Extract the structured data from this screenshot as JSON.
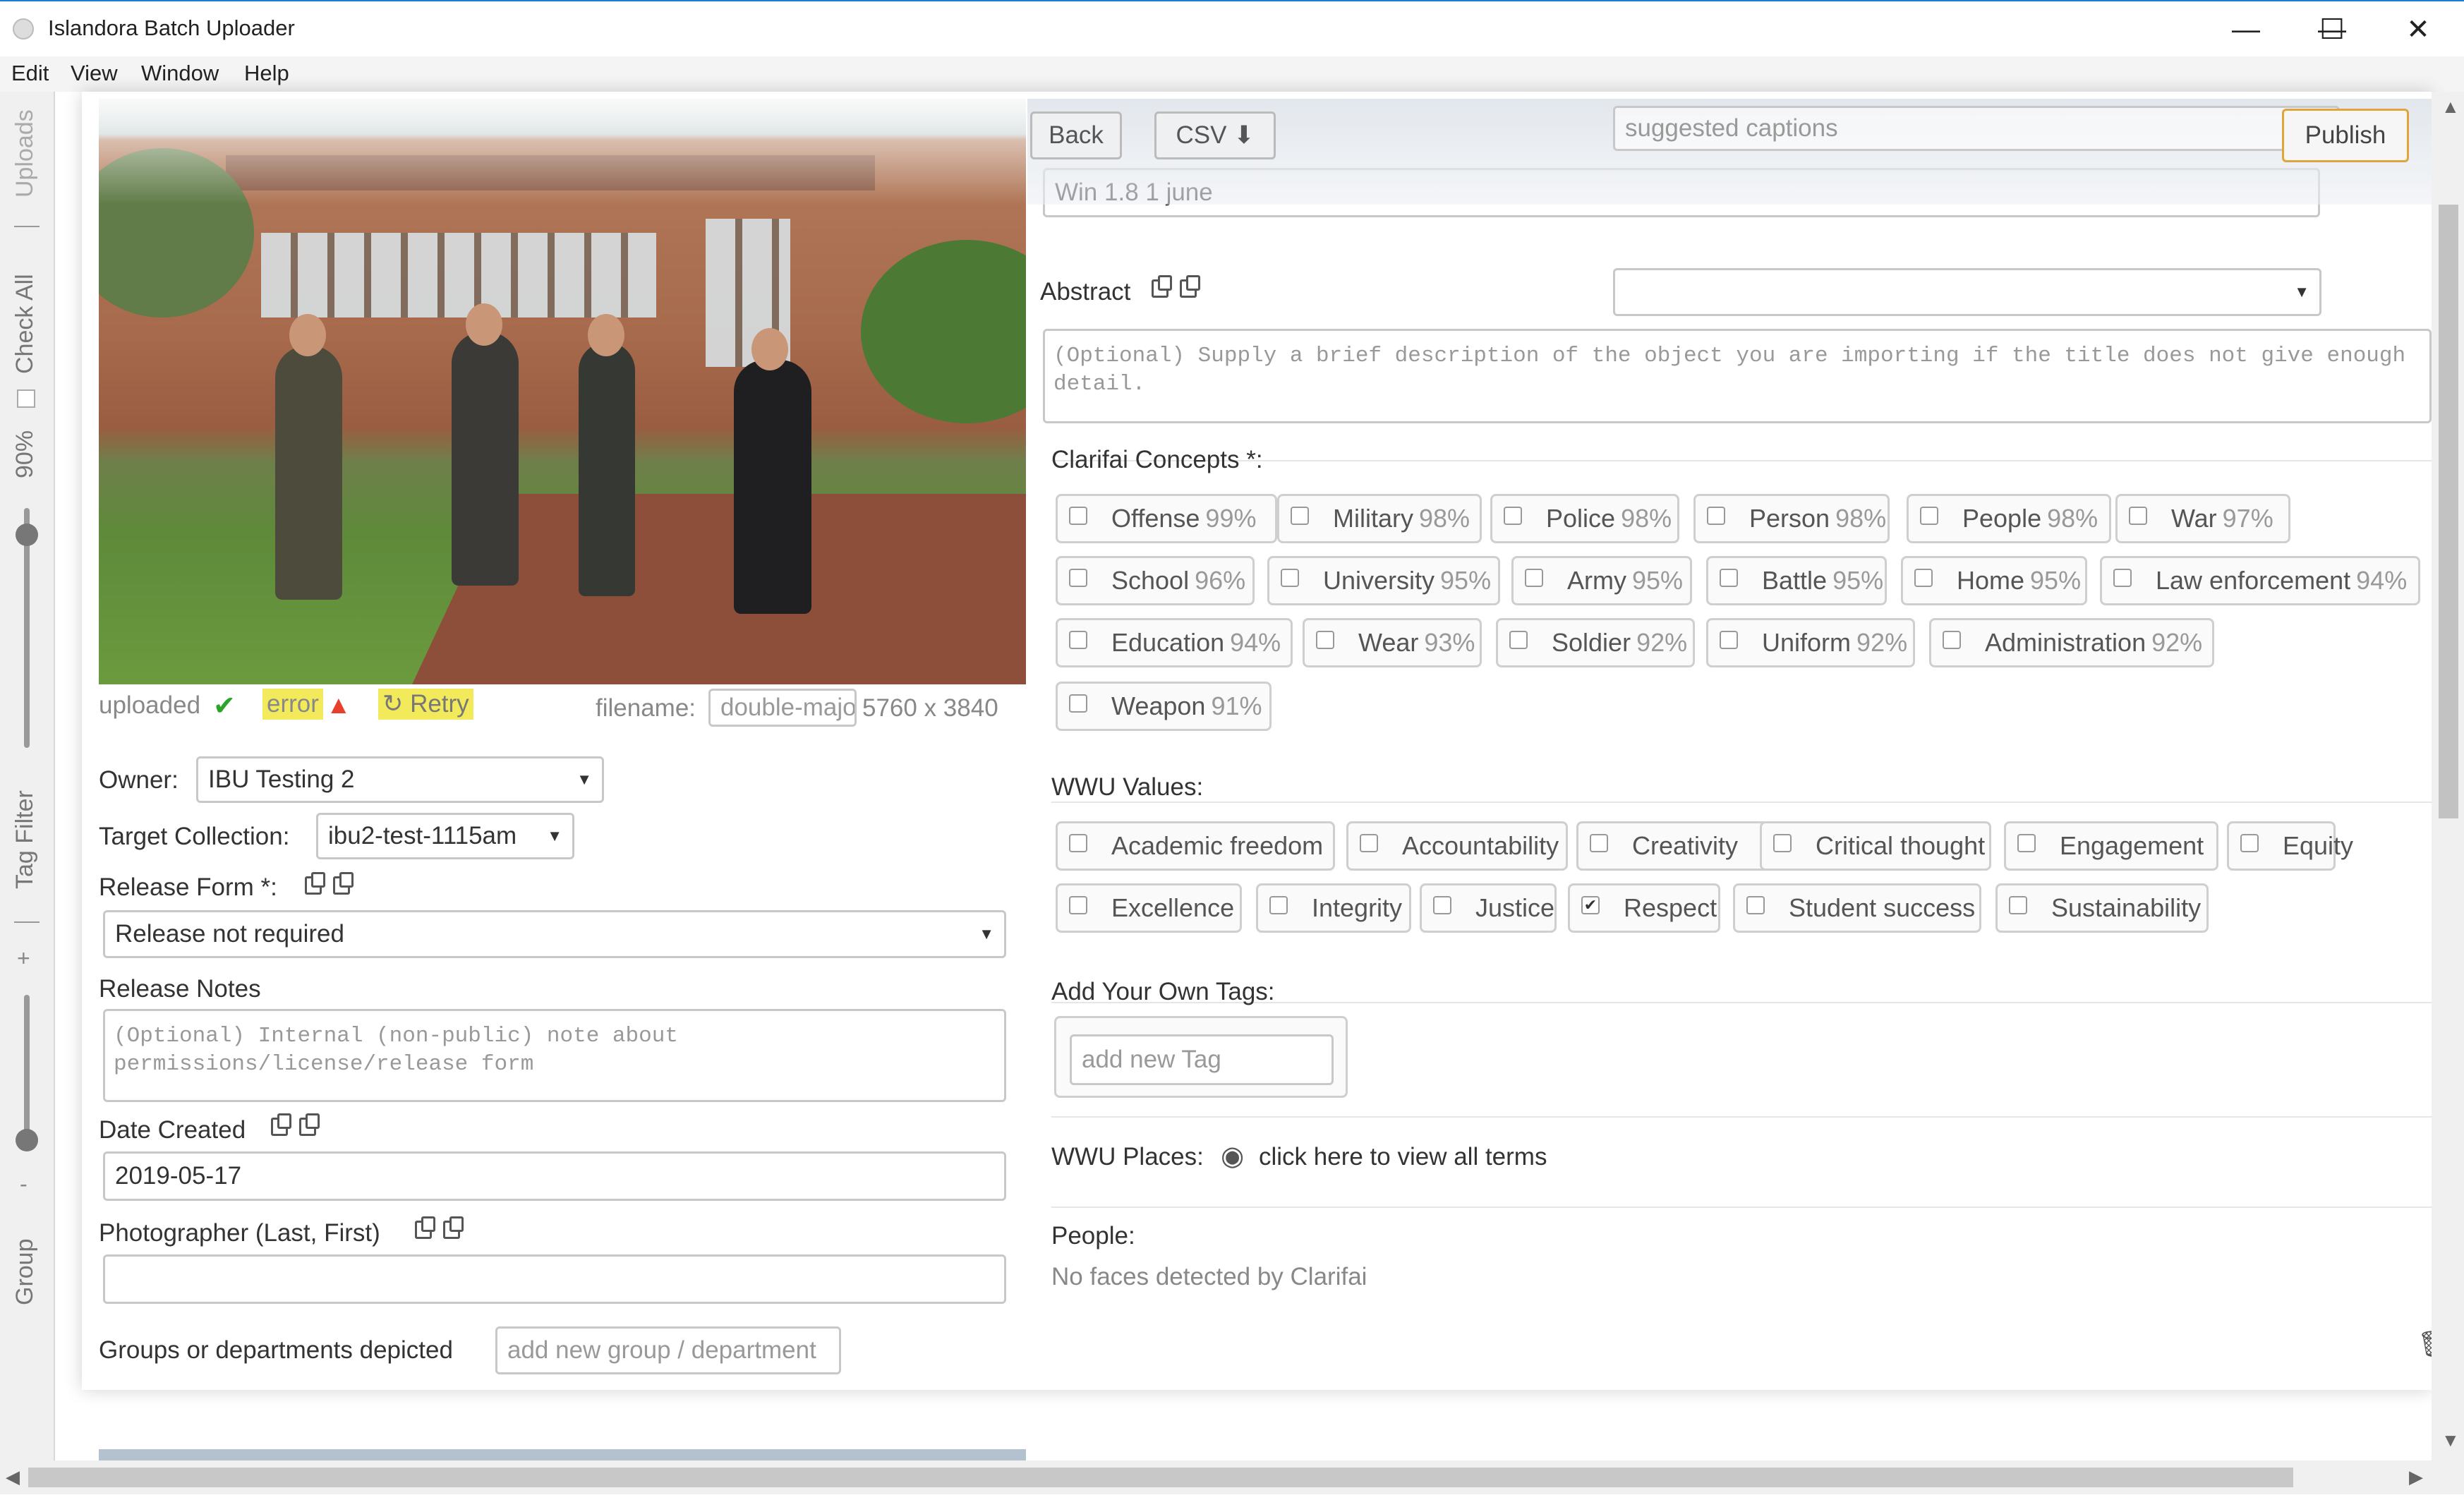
{
  "window": {
    "title": "Islandora Batch Uploader",
    "minimize": "—",
    "maximize": "☐",
    "close": "✕"
  },
  "menu": [
    "Edit",
    "View",
    "Window",
    "Help"
  ],
  "sidebar": {
    "uploads": "Uploads",
    "check_all": "Check All",
    "zoom": "90%",
    "tag_filter": "Tag Filter",
    "plus": "+",
    "minus": "-",
    "group": "Group"
  },
  "toolbar": {
    "back": "Back",
    "csv": "CSV",
    "captions_placeholder": "suggested captions",
    "publish": "Publish"
  },
  "status": {
    "uploaded": "uploaded",
    "error": "error",
    "retry": "Retry",
    "filename_label": "filename:",
    "filename_placeholder": "double-major",
    "dimensions": "5760 x 3840"
  },
  "form": {
    "owner_label": "Owner:",
    "owner_value": "IBU Testing 2",
    "collection_label": "Target Collection:",
    "collection_value": "ibu2-test-1115am",
    "release_form_label": "Release Form *:",
    "release_form_value": "Release not required",
    "release_notes_label": "Release Notes",
    "release_notes_placeholder": "(Optional) Internal (non-public) note about permissions/license/release form",
    "date_label": "Date Created",
    "date_value": "2019-05-17",
    "photographer_label": "Photographer (Last, First)",
    "photographer_value": "",
    "groups_label": "Groups or departments depicted",
    "groups_placeholder": "add new group / department"
  },
  "right": {
    "title_value": "Win 1.8 1 june",
    "abstract_label": "Abstract",
    "abstract_select": "",
    "abstract_placeholder": "(Optional) Supply a brief description of the object you are importing if the title does not give enough detail.",
    "concepts_label": "Clarifai Concepts *:",
    "concepts": [
      {
        "name": "Offense",
        "pct": "99%"
      },
      {
        "name": "Military",
        "pct": "98%"
      },
      {
        "name": "Police",
        "pct": "98%"
      },
      {
        "name": "Person",
        "pct": "98%"
      },
      {
        "name": "People",
        "pct": "98%"
      },
      {
        "name": "War",
        "pct": "97%"
      },
      {
        "name": "School",
        "pct": "96%"
      },
      {
        "name": "University",
        "pct": "95%"
      },
      {
        "name": "Army",
        "pct": "95%"
      },
      {
        "name": "Battle",
        "pct": "95%"
      },
      {
        "name": "Home",
        "pct": "95%"
      },
      {
        "name": "Law enforcement",
        "pct": "94%"
      },
      {
        "name": "Education",
        "pct": "94%"
      },
      {
        "name": "Wear",
        "pct": "93%"
      },
      {
        "name": "Soldier",
        "pct": "92%"
      },
      {
        "name": "Uniform",
        "pct": "92%"
      },
      {
        "name": "Administration",
        "pct": "92%"
      },
      {
        "name": "Weapon",
        "pct": "91%"
      }
    ],
    "values_label": "WWU Values:",
    "values": [
      {
        "name": "Academic freedom",
        "checked": false
      },
      {
        "name": "Accountability",
        "checked": false
      },
      {
        "name": "Creativity",
        "checked": false
      },
      {
        "name": "Critical thought",
        "checked": false
      },
      {
        "name": "Engagement",
        "checked": false
      },
      {
        "name": "Equity",
        "checked": false
      },
      {
        "name": "Excellence",
        "checked": false
      },
      {
        "name": "Integrity",
        "checked": false
      },
      {
        "name": "Justice",
        "checked": false
      },
      {
        "name": "Respect",
        "checked": true
      },
      {
        "name": "Student success",
        "checked": false
      },
      {
        "name": "Sustainability",
        "checked": false
      }
    ],
    "own_tags_label": "Add Your Own Tags:",
    "own_tags_placeholder": "add new Tag",
    "places_label": "WWU Places:",
    "places_link": "click here to view all terms",
    "people_label": "People:",
    "people_value": "No faces detected by Clarifai"
  }
}
